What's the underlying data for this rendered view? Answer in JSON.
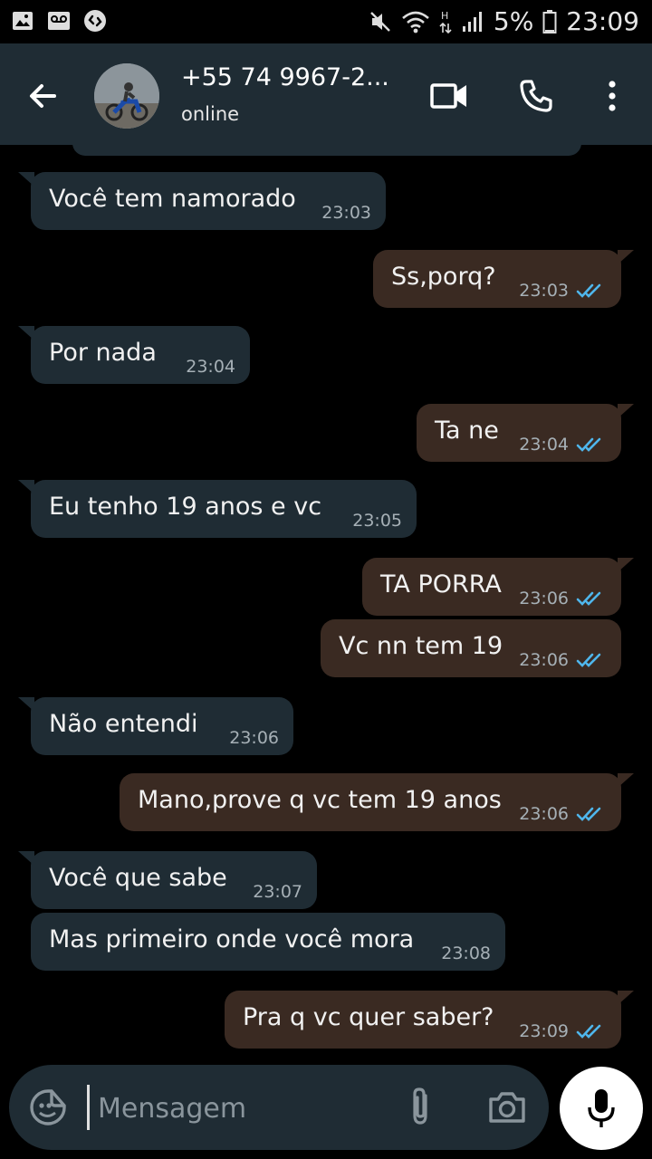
{
  "status_bar": {
    "left_icons": [
      "gallery-icon",
      "voicemail-icon",
      "shazam-icon"
    ],
    "right_icons": [
      "mute-icon",
      "wifi-icon",
      "hspa-icon",
      "signal-icon",
      "battery-icon"
    ],
    "battery": "5%",
    "time": "23:09"
  },
  "header": {
    "contact": "+55 74 9967-2...",
    "status": "online",
    "icons": [
      "back-arrow-icon",
      "video-call-icon",
      "phone-call-icon",
      "more-options-icon"
    ]
  },
  "messages": [
    {
      "dir": "in",
      "text": "Você tem namorado",
      "time": "23:03"
    },
    {
      "dir": "out",
      "text": "Ss,porq?",
      "time": "23:03",
      "read": true
    },
    {
      "dir": "in",
      "text": "Por nada",
      "time": "23:04"
    },
    {
      "dir": "out",
      "text": "Ta ne",
      "time": "23:04",
      "read": true
    },
    {
      "dir": "in",
      "text": "Eu tenho 19 anos e vc",
      "time": "23:05"
    },
    {
      "dir": "out",
      "text": "TA PORRA",
      "time": "23:06",
      "read": true
    },
    {
      "dir": "out",
      "text": "Vc nn tem 19",
      "time": "23:06",
      "read": true
    },
    {
      "dir": "in",
      "text": "Não entendi",
      "time": "23:06"
    },
    {
      "dir": "out",
      "text": "Mano,prove q vc tem 19 anos",
      "time": "23:06",
      "read": true
    },
    {
      "dir": "in",
      "text": "Você que sabe",
      "time": "23:07"
    },
    {
      "dir": "in",
      "text": "Mas primeiro onde você mora",
      "time": "23:08"
    },
    {
      "dir": "out",
      "text": "Pra q vc quer saber?",
      "time": "23:09",
      "read": true
    }
  ],
  "input": {
    "placeholder": "Mensagem",
    "icons": [
      "emoji-sticker-icon",
      "attach-icon",
      "camera-icon",
      "mic-icon"
    ]
  },
  "colors": {
    "background": "#000000",
    "incoming_bubble": "#1f2c34",
    "outgoing_bubble": "#3a2a22",
    "read_ticks": "#4fb6ec",
    "header": "#1f2c34"
  }
}
